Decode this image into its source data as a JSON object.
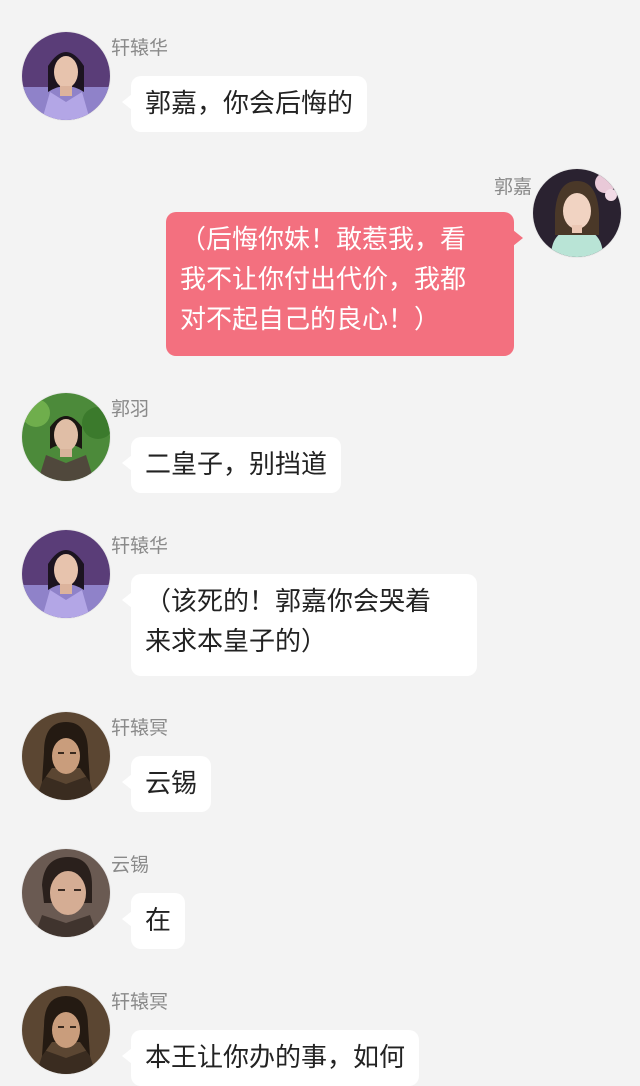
{
  "messages": [
    {
      "sender": "轩辕华",
      "text": "郭嘉，你会后悔的",
      "side": "left",
      "avatar": "avatar-xuanyuanhua"
    },
    {
      "sender": "郭嘉",
      "text": "（后悔你妹！敢惹我，看\n我不让你付出代价，我都\n对不起自己的良心！）",
      "side": "right",
      "avatar": "avatar-guojia",
      "bubble_color": "#f3707f"
    },
    {
      "sender": "郭羽",
      "text": "二皇子，别挡道",
      "side": "left",
      "avatar": "avatar-guoyu"
    },
    {
      "sender": "轩辕华",
      "text": "（该死的！郭嘉你会哭着\n来求本皇子的）",
      "side": "left",
      "avatar": "avatar-xuanyuanhua"
    },
    {
      "sender": "轩辕冥",
      "text": "云锡",
      "side": "left",
      "avatar": "avatar-xuanyuanming"
    },
    {
      "sender": "云锡",
      "text": "在",
      "side": "left",
      "avatar": "avatar-yunxi"
    },
    {
      "sender": "轩辕冥",
      "text": "本王让你办的事，如何",
      "side": "left",
      "avatar": "avatar-xuanyuanming"
    }
  ],
  "colors": {
    "background": "#f3f3f3",
    "incoming_bubble": "#ffffff",
    "outgoing_bubble": "#f3707f"
  }
}
